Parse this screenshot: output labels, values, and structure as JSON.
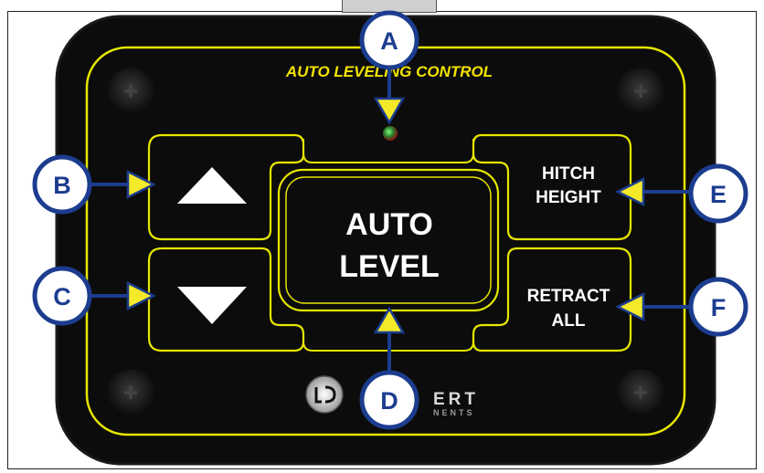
{
  "panel": {
    "title": "AUTO LEVELING CONTROL",
    "up_arrow_icon": "triangle-up-icon",
    "down_arrow_icon": "triangle-down-icon",
    "auto_level": {
      "line1": "AUTO",
      "line2": "LEVEL"
    },
    "hitch_height": {
      "line1": "HITCH",
      "line2": "HEIGHT"
    },
    "retract_all": {
      "line1": "RETRACT",
      "line2": "ALL"
    },
    "brand_logo_text": "ERT",
    "brand_logo_sub": "NENTS"
  },
  "callouts": {
    "a": "A",
    "b": "B",
    "c": "C",
    "d": "D",
    "e": "E",
    "f": "F"
  },
  "colors": {
    "panel_bg": "#0c0c0c",
    "outline_yellow": "#e6e600",
    "callout_blue": "#1c3d8f",
    "arrow_yellow": "#f5ea2a",
    "title_yellow": "#f2e300"
  }
}
